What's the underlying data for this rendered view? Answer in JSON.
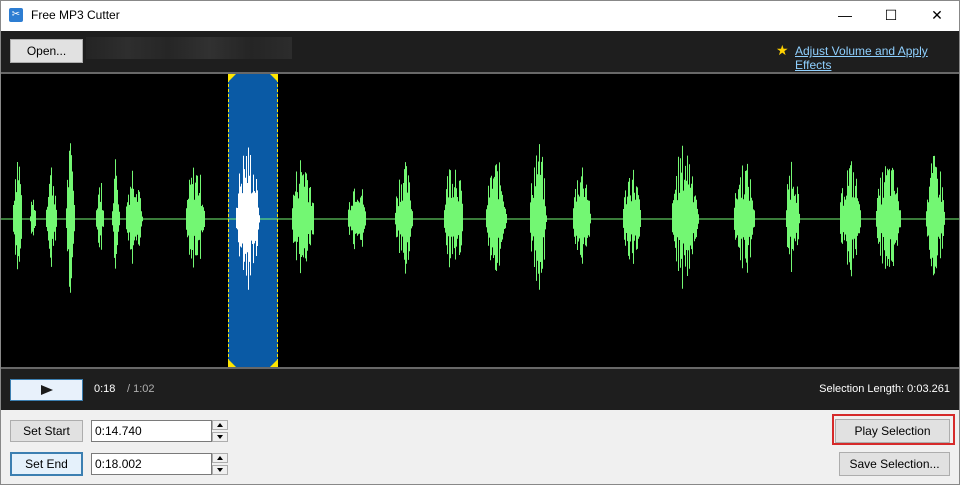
{
  "window": {
    "title": "Free MP3 Cutter",
    "icon": "scissors-icon"
  },
  "toolbar": {
    "open_label": "Open...",
    "effects_link": "Adjust Volume and Apply Effects",
    "effects_icon": "star-icon"
  },
  "colors": {
    "waveform": "#73f773",
    "selection": "#0a5aa5",
    "selection_wave": "#ffffff",
    "handles": "#ffe600"
  },
  "transport": {
    "play_icon": "play-icon",
    "current_time": "0:18",
    "total_time": "/ 1:02",
    "selection_length": "Selection Length: 0:03.261"
  },
  "controls": {
    "set_start_label": "Set Start",
    "start_value": "0:14.740",
    "set_end_label": "Set End",
    "end_value": "0:18.002",
    "play_selection_label": "Play Selection",
    "save_selection_label": "Save Selection..."
  }
}
